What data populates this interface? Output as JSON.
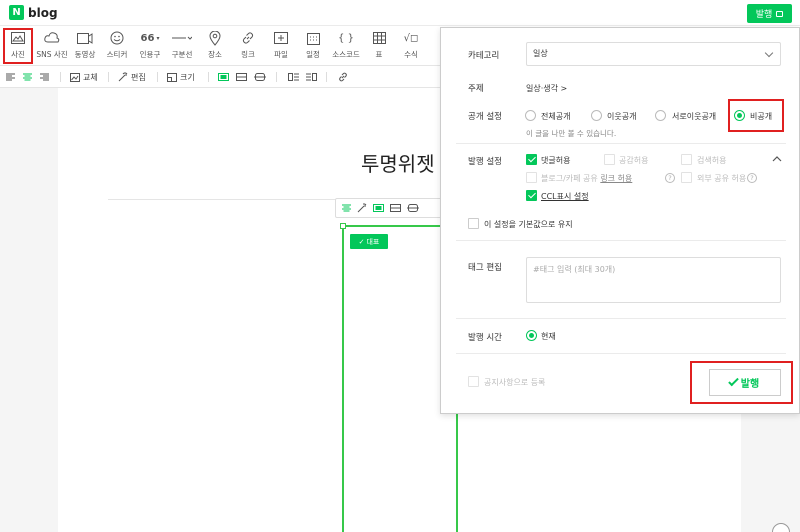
{
  "header": {
    "logo_letter": "N",
    "logo_text": "blog",
    "publish_label": "발행"
  },
  "toolbar": [
    {
      "name": "photo",
      "label": "사진",
      "icon": "image-icon"
    },
    {
      "name": "sns-photo",
      "label": "SNS 사진",
      "icon": "cloud-icon"
    },
    {
      "name": "video",
      "label": "동영상",
      "icon": "video-icon"
    },
    {
      "name": "sticker",
      "label": "스티커",
      "icon": "smile-icon"
    },
    {
      "name": "quote",
      "label": "인용구",
      "icon": "quote-icon",
      "glyph": "66"
    },
    {
      "name": "divider",
      "label": "구분선",
      "icon": "divider-icon"
    },
    {
      "name": "place",
      "label": "장소",
      "icon": "pin-icon"
    },
    {
      "name": "link",
      "label": "링크",
      "icon": "link-icon"
    },
    {
      "name": "file",
      "label": "파일",
      "icon": "file-icon"
    },
    {
      "name": "schedule",
      "label": "일정",
      "icon": "calendar-icon"
    },
    {
      "name": "source-code",
      "label": "소스코드",
      "icon": "braces-icon",
      "glyph": "{ }"
    },
    {
      "name": "table",
      "label": "표",
      "icon": "table-icon"
    },
    {
      "name": "formula",
      "label": "수식",
      "icon": "sqrt-icon",
      "glyph": "√◻"
    }
  ],
  "subbar": {
    "replace_label": "교체",
    "edit_label": "편집",
    "size_label": "크기"
  },
  "editor": {
    "doc_title": "투명위젯",
    "rep_badge": "대표"
  },
  "panel": {
    "category_label": "카테고리",
    "category_value": "일상",
    "topic_label": "주제",
    "topic_value": "일상·생각 >",
    "visibility_label": "공개 설정",
    "visibility_options": [
      "전체공개",
      "이웃공개",
      "서로이웃공개",
      "비공개"
    ],
    "visibility_hint": "이 글을 나만 볼 수 있습니다.",
    "publish_settings_label": "발행 설정",
    "opt_comments": "댓글허용",
    "opt_likes": "공감허용",
    "opt_search": "검색허용",
    "opt_blog_share": "블로그/카페 공유",
    "opt_link_allow": "링크 허용",
    "opt_external_share": "외부 공유 허용",
    "opt_ccl": "CCL표시 설정",
    "keep_default": "이 설정을 기본값으로 유지",
    "tag_label": "태그 편집",
    "tag_placeholder": "#태그 입력 (최대 30개)",
    "publish_time_label": "발행 시간",
    "publish_time_value": "현재",
    "notice_label": "공지사항으로 등록",
    "publish_button": "발행"
  },
  "colors": {
    "accent": "#03c75a",
    "highlight": "#e02020"
  }
}
